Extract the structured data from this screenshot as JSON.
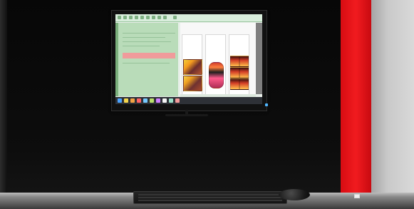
{
  "scene": {
    "wall_color": "#0b0b0b",
    "accent_red": "#e31619",
    "screen_app_accent": "#b9dcb9"
  },
  "icons": {
    "toolbar": [
      "toolbar-icon",
      "toolbar-icon",
      "toolbar-icon",
      "toolbar-icon",
      "toolbar-icon",
      "toolbar-icon",
      "toolbar-icon",
      "toolbar-icon",
      "toolbar-icon",
      "toolbar-icon"
    ],
    "taskbar": [
      "start-icon",
      "app-icon",
      "app-icon",
      "app-icon",
      "app-icon",
      "app-icon",
      "app-icon",
      "app-icon",
      "app-icon",
      "app-icon"
    ]
  }
}
